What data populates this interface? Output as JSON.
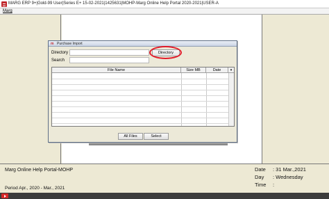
{
  "window": {
    "title": "MARG ERP 9+|Gold-99 User|Series E+ 15-02-2021|1425631|MOHP-Marg Online Help Portal 2020-2021|USER-A"
  },
  "menu": {
    "items": [
      {
        "label": "Marg"
      }
    ]
  },
  "dialog": {
    "title": "Purchase Import",
    "directory_label": "Directory",
    "directory_value": "",
    "directory_button": "Directory",
    "search_label": "Search",
    "search_value": "",
    "table": {
      "columns": [
        "File Name",
        "Size MB",
        "Date"
      ],
      "rows": []
    },
    "buttons": {
      "all_files": "All Files",
      "select": "Select"
    },
    "highlight_color": "#e21b2a"
  },
  "footer": {
    "portal": "Marg Online Help Portal-MOHP",
    "period": "Period Apr., 2020 - Mar., 2021",
    "date_label": "Date",
    "date_value": ": 31 Mar.,2021",
    "day_label": "Day",
    "day_value": ": Wednesday",
    "time_label": "Time",
    "time_value": ":"
  },
  "icons": {
    "app": "marg-logo-icon",
    "dialog": "marg-logo-icon",
    "taskbar": "youtube-play-icon"
  }
}
